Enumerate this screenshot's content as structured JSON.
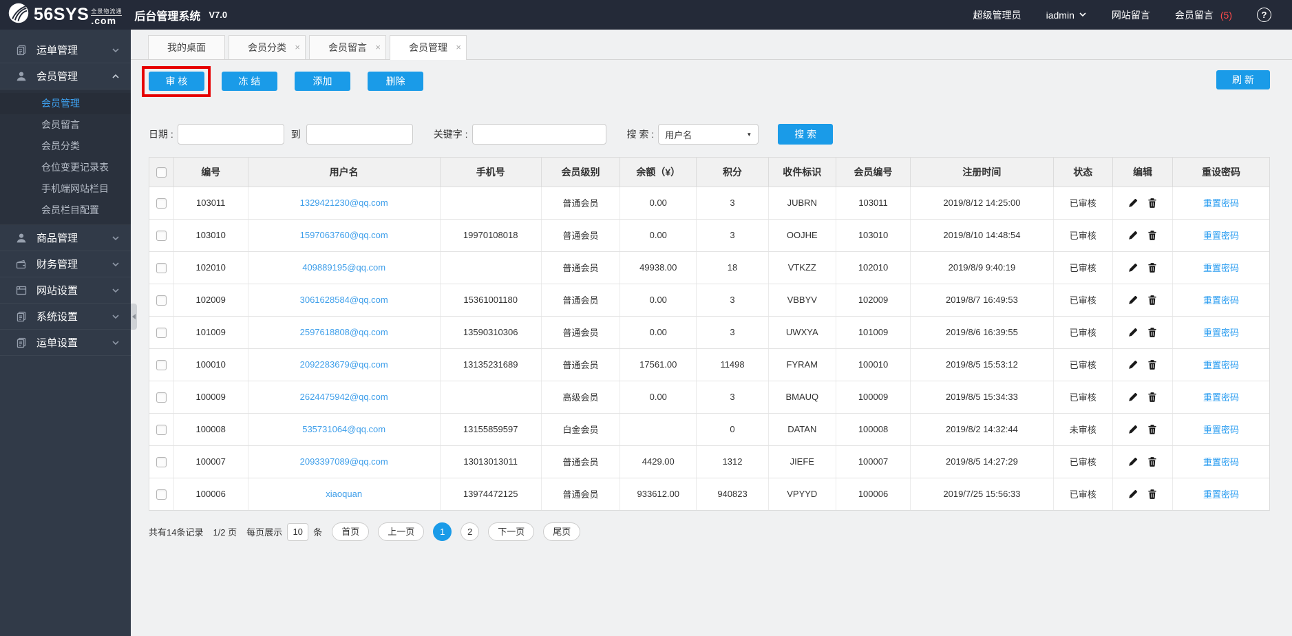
{
  "colors": {
    "accent": "#1a9be8",
    "link": "#3f9fea",
    "topbar_bg": "#242a38",
    "sidebar_bg": "#313a48",
    "annotation_highlight": "#e60000",
    "message_count": "#ff4a4a",
    "active_menu_text": "#3ea2f2"
  },
  "topbar": {
    "logo_main": "56SYS",
    "logo_tagline": "全景物流通",
    "logo_domain": ".com",
    "app_title": "后台管理系统",
    "version": "V7.0",
    "role": "超级管理员",
    "username": "iadmin",
    "nav_site_messages": "网站留言",
    "nav_member_messages": "会员留言",
    "member_message_count": "(5)",
    "help_icon": "?"
  },
  "sidebar": {
    "items": [
      {
        "label": "运单管理",
        "icon": "waybill-icon",
        "state": "collapsed"
      },
      {
        "label": "会员管理",
        "icon": "member-icon",
        "state": "expanded",
        "children": [
          {
            "label": "会员管理",
            "active": true
          },
          {
            "label": "会员留言",
            "active": false
          },
          {
            "label": "会员分类",
            "active": false
          },
          {
            "label": "仓位变更记录表",
            "active": false
          },
          {
            "label": "手机端网站栏目",
            "active": false
          },
          {
            "label": "会员栏目配置",
            "active": false
          }
        ]
      },
      {
        "label": "商品管理",
        "icon": "goods-icon",
        "state": "collapsed"
      },
      {
        "label": "财务管理",
        "icon": "finance-icon",
        "state": "collapsed"
      },
      {
        "label": "网站设置",
        "icon": "website-icon",
        "state": "collapsed"
      },
      {
        "label": "系统设置",
        "icon": "system-icon",
        "state": "collapsed"
      },
      {
        "label": "运单设置",
        "icon": "waybill-settings-icon",
        "state": "collapsed"
      }
    ]
  },
  "tabs": [
    {
      "label": "我的桌面",
      "closable": false,
      "active": false
    },
    {
      "label": "会员分类",
      "closable": true,
      "active": false
    },
    {
      "label": "会员留言",
      "closable": true,
      "active": false
    },
    {
      "label": "会员管理",
      "closable": true,
      "active": true
    }
  ],
  "toolbar": {
    "actions": [
      "审 核",
      "冻 结",
      "添加",
      "删除"
    ],
    "highlighted_action": "审 核",
    "refresh_label": "刷 新"
  },
  "filters": {
    "date_label": "日期 :",
    "date_from_value": "",
    "to_label": "到",
    "date_to_value": "",
    "keyword_label": "关键字 :",
    "keyword_value": "",
    "search_type_label": "搜 索 :",
    "search_type_value": "用户名",
    "search_button_label": "搜 索"
  },
  "table": {
    "columns": [
      "编号",
      "用户名",
      "手机号",
      "会员级别",
      "余额（¥）",
      "积分",
      "收件标识",
      "会员编号",
      "注册时间",
      "状态",
      "编辑",
      "重设密码"
    ],
    "reset_link_label": "重置密码",
    "rows": [
      {
        "id": "103011",
        "username": "1329421230@qq.com",
        "phone": "",
        "level": "普通会员",
        "balance": "0.00",
        "points": "3",
        "receiver_code": "JUBRN",
        "member_no": "103011",
        "registered": "2019/8/12 14:25:00",
        "status": "已审核"
      },
      {
        "id": "103010",
        "username": "1597063760@qq.com",
        "phone": "19970108018",
        "level": "普通会员",
        "balance": "0.00",
        "points": "3",
        "receiver_code": "OOJHE",
        "member_no": "103010",
        "registered": "2019/8/10 14:48:54",
        "status": "已审核"
      },
      {
        "id": "102010",
        "username": "409889195@qq.com",
        "phone": "",
        "level": "普通会员",
        "balance": "49938.00",
        "points": "18",
        "receiver_code": "VTKZZ",
        "member_no": "102010",
        "registered": "2019/8/9 9:40:19",
        "status": "已审核"
      },
      {
        "id": "102009",
        "username": "3061628584@qq.com",
        "phone": "15361001180",
        "level": "普通会员",
        "balance": "0.00",
        "points": "3",
        "receiver_code": "VBBYV",
        "member_no": "102009",
        "registered": "2019/8/7 16:49:53",
        "status": "已审核"
      },
      {
        "id": "101009",
        "username": "2597618808@qq.com",
        "phone": "13590310306",
        "level": "普通会员",
        "balance": "0.00",
        "points": "3",
        "receiver_code": "UWXYA",
        "member_no": "101009",
        "registered": "2019/8/6 16:39:55",
        "status": "已审核"
      },
      {
        "id": "100010",
        "username": "2092283679@qq.com",
        "phone": "13135231689",
        "level": "普通会员",
        "balance": "17561.00",
        "points": "11498",
        "receiver_code": "FYRAM",
        "member_no": "100010",
        "registered": "2019/8/5 15:53:12",
        "status": "已审核"
      },
      {
        "id": "100009",
        "username": "2624475942@qq.com",
        "phone": "",
        "level": "高级会员",
        "balance": "0.00",
        "points": "3",
        "receiver_code": "BMAUQ",
        "member_no": "100009",
        "registered": "2019/8/5 15:34:33",
        "status": "已审核"
      },
      {
        "id": "100008",
        "username": "535731064@qq.com",
        "phone": "13155859597",
        "level": "白金会员",
        "balance": "",
        "points": "0",
        "receiver_code": "DATAN",
        "member_no": "100008",
        "registered": "2019/8/2 14:32:44",
        "status": "未审核"
      },
      {
        "id": "100007",
        "username": "2093397089@qq.com",
        "phone": "13013013011",
        "level": "普通会员",
        "balance": "4429.00",
        "points": "1312",
        "receiver_code": "JIEFE",
        "member_no": "100007",
        "registered": "2019/8/5 14:27:29",
        "status": "已审核"
      },
      {
        "id": "100006",
        "username": "xiaoquan",
        "phone": "13974472125",
        "level": "普通会员",
        "balance": "933612.00",
        "points": "940823",
        "receiver_code": "VPYYD",
        "member_no": "100006",
        "registered": "2019/7/25 15:56:33",
        "status": "已审核"
      }
    ]
  },
  "pagination": {
    "total_text": "共有14条记录",
    "page_indicator": "1/2 页",
    "per_page_label": "每页展示",
    "per_page_value": "10",
    "per_page_unit": "条",
    "first_label": "首页",
    "prev_label": "上一页",
    "pages": [
      "1",
      "2"
    ],
    "active_page": "1",
    "next_label": "下一页",
    "last_label": "尾页"
  }
}
